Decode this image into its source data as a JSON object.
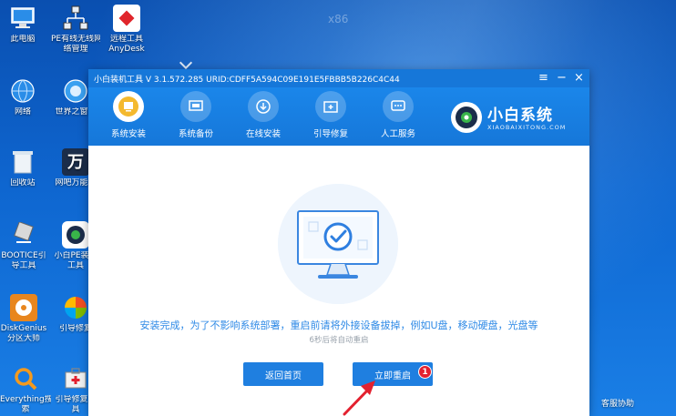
{
  "desktop": {
    "watermark": "x86",
    "icons": [
      {
        "label1": "此电脑",
        "label2": "",
        "icon": "computer-icon"
      },
      {
        "label1": "PE有线无线网",
        "label2": "络管理",
        "icon": "network-manager-icon"
      },
      {
        "label1": "远程工具",
        "label2": "AnyDesk",
        "icon": "anydesk-icon"
      },
      {
        "label1": "网络",
        "label2": "",
        "icon": "network-icon"
      },
      {
        "label1": "世界之窗浏",
        "label2": "",
        "icon": "browser-icon"
      },
      {
        "label1": "回收站",
        "label2": "",
        "icon": "recycle-bin-icon"
      },
      {
        "label1": "网吧万能驱",
        "label2": "",
        "icon": "driver-icon"
      },
      {
        "label1": "BOOTICE引",
        "label2": "导工具",
        "icon": "bootice-icon"
      },
      {
        "label1": "小白PE装机",
        "label2": "工具",
        "icon": "xiaobai-pe-icon"
      },
      {
        "label1": "DiskGenius",
        "label2": "分区大师",
        "icon": "diskgenius-icon"
      },
      {
        "label1": "引导修复",
        "label2": "",
        "icon": "boot-repair-icon"
      },
      {
        "label1": "Everything搜",
        "label2": "索",
        "icon": "everything-icon"
      },
      {
        "label1": "引导修复工",
        "label2": "具",
        "icon": "boot-repair-tool-icon"
      }
    ],
    "helper_label": "客服协助"
  },
  "window": {
    "title": "小白装机工具 V 3.1.572.285 URID:CDFF5A594C09E191E5FBBB5B226C4C44",
    "menu_icon": "menu-icon",
    "minimize_icon": "minimize-icon",
    "close_icon": "close-icon",
    "tabs": [
      {
        "label": "系统安装",
        "icon": "system-install-icon",
        "active": true
      },
      {
        "label": "系统备份",
        "icon": "system-backup-icon",
        "active": false
      },
      {
        "label": "在线安装",
        "icon": "online-install-icon",
        "active": false
      },
      {
        "label": "引导修复",
        "icon": "boot-repair-icon",
        "active": false
      },
      {
        "label": "人工服务",
        "icon": "support-chat-icon",
        "active": false
      }
    ],
    "brand_name": "小白系统",
    "brand_sub": "XIAOBAIXITONG.COM"
  },
  "content": {
    "message": "安装完成，为了不影响系统部署，重启前请将外接设备拔掉，例如U盘，移动硬盘，光盘等",
    "countdown": "6秒后将自动重启",
    "back_button": "返回首页",
    "restart_button": "立即重启",
    "badge": "1"
  },
  "colors": {
    "accent": "#1677d9",
    "button": "#1f7fe0",
    "message": "#2f8ae6",
    "badge": "#e3212f"
  }
}
